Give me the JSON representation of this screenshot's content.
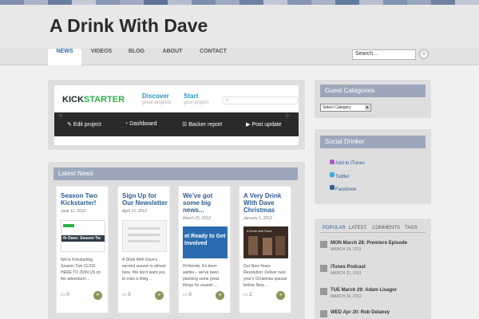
{
  "site": {
    "title": "A Drink With Dave"
  },
  "nav": {
    "items": [
      "NEWS",
      "VIDEOS",
      "BLOG",
      "ABOUT",
      "CONTACT"
    ]
  },
  "search": {
    "placeholder": "Search..."
  },
  "kickstarter": {
    "logo_a": "KICK",
    "logo_b": "STARTER",
    "discover": "Discover",
    "discover_sub": "great projects",
    "start": "Start",
    "start_sub": "your project",
    "bar": [
      "Edit project",
      "Dashboard",
      "Backer report",
      "Post update"
    ]
  },
  "latest": {
    "title": "Latest News",
    "cards": [
      {
        "title": "Season Two Kickstarter!",
        "date": "June 11, 2012",
        "excerpt": "We're Kickstarting Season Two CLICK HERE TO JOIN US on the adventure!...",
        "comments": "0"
      },
      {
        "title": "Sign Up for Our Newsletter",
        "date": "April 16, 2012",
        "excerpt": "A Drink With Dave's second season is almost here. We don't want you to miss a thing ...",
        "comments": "0"
      },
      {
        "title": "We've got some big news...",
        "date": "March 25, 2012",
        "excerpt": "Hi friends, It's been awhile – we've been planning some great things for season ...",
        "comments": "0"
      },
      {
        "title": "A Very Drink With Dave Christmas",
        "date": "January 1, 2012",
        "excerpt": "Our New Years Resolution: Deliver next year's Christmas special before New ...",
        "comments": "2"
      }
    ],
    "img_texts": [
      "th Dave: Season Tw",
      "et Ready to Get Involved",
      "A Drink with Dave"
    ]
  },
  "guest": {
    "title": "Guest Categories",
    "select": "Select Category"
  },
  "social": {
    "title": "Social Drinker",
    "links": [
      "Add to iTunes",
      "Twitter",
      "Facebook"
    ]
  },
  "tabs": [
    "POPULAR",
    "LATEST",
    "COMMENTS",
    "TAGS"
  ],
  "popular": [
    {
      "title": "MON March 28: Premiere Episode",
      "date": "MARCH 29, 2011"
    },
    {
      "title": "iTunes Podcast",
      "date": "MARCH 31, 2011"
    },
    {
      "title": "TUE March 29: Adam Lisagor",
      "date": "MARCH 30, 2011"
    },
    {
      "title": "WED Apr 20: Rob Delaney",
      "date": ""
    }
  ],
  "colors": {
    "accent": "#2c5d91",
    "widget_bar": "#9ca7bc",
    "kick_green": "#2bb34a"
  }
}
